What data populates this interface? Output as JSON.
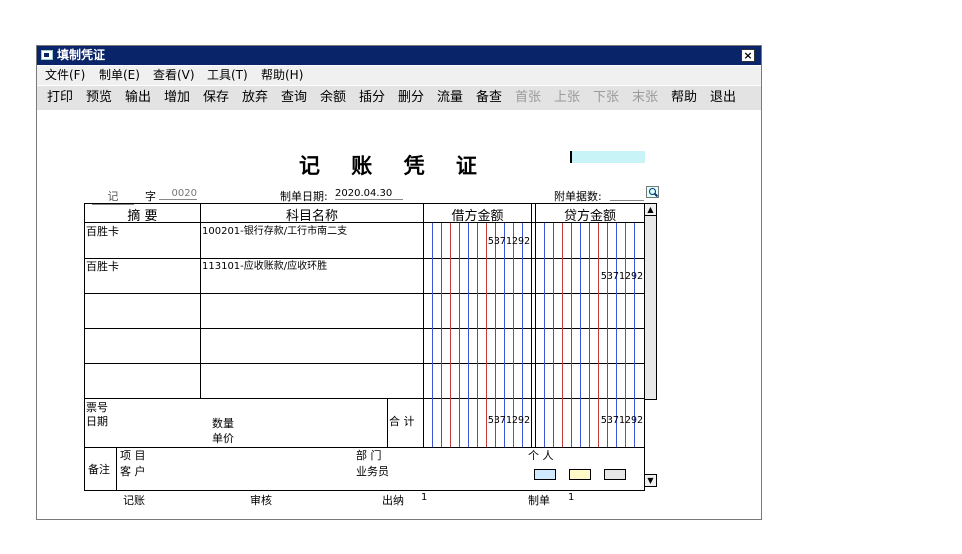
{
  "window": {
    "title": "填制凭证",
    "close_label": "×"
  },
  "menu": [
    {
      "label": "文件(F)"
    },
    {
      "label": "制单(E)"
    },
    {
      "label": "查看(V)"
    },
    {
      "label": "工具(T)"
    },
    {
      "label": "帮助(H)"
    }
  ],
  "toolbar": [
    {
      "label": "打印",
      "enabled": true
    },
    {
      "label": "预览",
      "enabled": true
    },
    {
      "label": "输出",
      "enabled": true
    },
    {
      "label": "增加",
      "enabled": true
    },
    {
      "label": "保存",
      "enabled": true
    },
    {
      "label": "放弃",
      "enabled": true
    },
    {
      "label": "查询",
      "enabled": true
    },
    {
      "label": "余额",
      "enabled": true
    },
    {
      "label": "插分",
      "enabled": true
    },
    {
      "label": "删分",
      "enabled": true
    },
    {
      "label": "流量",
      "enabled": true
    },
    {
      "label": "备查",
      "enabled": true
    },
    {
      "label": "首张",
      "enabled": false
    },
    {
      "label": "上张",
      "enabled": false
    },
    {
      "label": "下张",
      "enabled": false
    },
    {
      "label": "末张",
      "enabled": false
    },
    {
      "label": "帮助",
      "enabled": true
    },
    {
      "label": "退出",
      "enabled": true
    }
  ],
  "voucher": {
    "title": "记 账 凭 证",
    "type": "记",
    "zi_label": "字",
    "number": "0020",
    "date_label": "制单日期:",
    "date": "2020.04.30",
    "attachments_label": "附单据数:",
    "attachments_value": "",
    "headers": {
      "summary": "摘 要",
      "account": "科目名称",
      "debit": "借方金额",
      "credit": "贷方金额"
    },
    "entries": [
      {
        "summary": "百胜卡",
        "account": "100201-银行存款/工行市南二支",
        "debit": "5371292",
        "credit": ""
      },
      {
        "summary": "百胜卡",
        "account": "113101-应收账款/应收环胜",
        "debit": "",
        "credit": "5371292"
      },
      {
        "summary": "",
        "account": "",
        "debit": "",
        "credit": ""
      },
      {
        "summary": "",
        "account": "",
        "debit": "",
        "credit": ""
      },
      {
        "summary": "",
        "account": "",
        "debit": "",
        "credit": ""
      }
    ],
    "footer": {
      "ticket_label": "票号",
      "date_label": "日期",
      "qty_label": "数量",
      "price_label": "单价",
      "total_label": "合 计",
      "debit_total": "5371292",
      "credit_total": "5371292",
      "remarks_label": "备注",
      "project_label": "项  目",
      "customer_label": "客  户",
      "dept_label": "部  门",
      "salesperson_label": "业务员",
      "person_label": "个  人"
    },
    "signatures": {
      "bookkeeper_label": "记账",
      "bookkeeper": "",
      "auditor_label": "审核",
      "auditor": "",
      "cashier_label": "出纳",
      "cashier": "1",
      "maker_label": "制单",
      "maker": "1"
    }
  }
}
